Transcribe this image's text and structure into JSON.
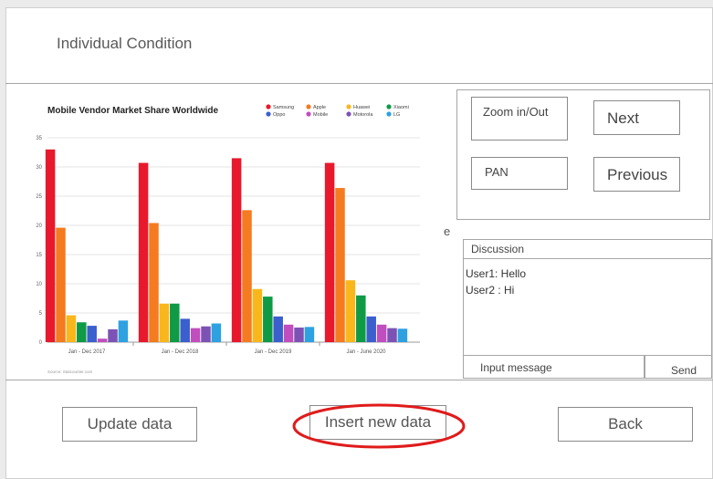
{
  "page": {
    "title": "Individual Condition"
  },
  "controls": {
    "zoom_label": "Zoom in/Out",
    "next_label": "Next",
    "pan_label": "PAN",
    "previous_label": "Previous"
  },
  "stray_text": "e",
  "discussion": {
    "title": "Discussion",
    "messages": [
      "User1: Hello",
      "User2 : Hi"
    ],
    "input_placeholder": "Input message",
    "send_label": "Send"
  },
  "actions": {
    "update_label": "Update data",
    "insert_label": "Insert new data",
    "back_label": "Back"
  },
  "annotation": {
    "highlight_color": "#e01b1b"
  },
  "chart_data": {
    "type": "bar",
    "title": "Mobile Vendor Market Share Worldwide",
    "source": "Source: Statcounter.com",
    "categories": [
      "Jan - Dec 2017",
      "Jan - Dec 2018",
      "Jan - Dec 2019",
      "Jan - June 2020"
    ],
    "ylim": [
      0,
      35
    ],
    "yticks": [
      0,
      5,
      10,
      15,
      20,
      25,
      30,
      35
    ],
    "grid": true,
    "legend_position": "top-right",
    "series": [
      {
        "name": "Samsung",
        "color": "#e8192c",
        "values": [
          33.0,
          30.7,
          31.5,
          30.7
        ]
      },
      {
        "name": "Apple",
        "color": "#f47b20",
        "values": [
          19.6,
          20.4,
          22.6,
          26.4
        ]
      },
      {
        "name": "Huawei",
        "color": "#f9b71c",
        "values": [
          4.6,
          6.6,
          9.1,
          10.6
        ]
      },
      {
        "name": "Xiaomi",
        "color": "#0f9a46",
        "values": [
          3.4,
          6.6,
          7.8,
          8.0
        ]
      },
      {
        "name": "Oppo",
        "color": "#3b5fcd",
        "values": [
          2.8,
          4.0,
          4.4,
          4.4
        ]
      },
      {
        "name": "Mobile",
        "color": "#c04ebf",
        "values": [
          0.6,
          2.4,
          3.0,
          3.0
        ]
      },
      {
        "name": "Motorola",
        "color": "#7d52b5",
        "values": [
          2.2,
          2.7,
          2.5,
          2.4
        ]
      },
      {
        "name": "LG",
        "color": "#2ea1e0",
        "values": [
          3.7,
          3.2,
          2.6,
          2.3
        ]
      }
    ]
  }
}
